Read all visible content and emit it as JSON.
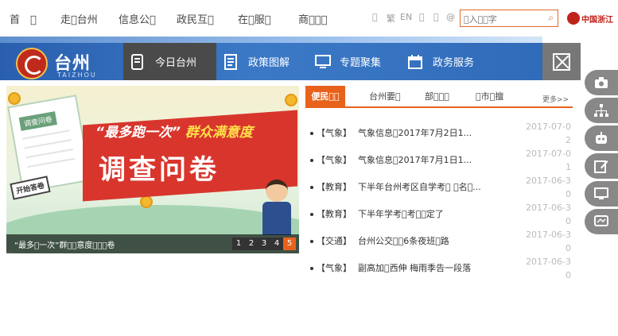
{
  "topnav": {
    "items": [
      "首　󰀀",
      "走󰀀台州",
      "信息公󰀀",
      "政民互󰀀",
      "在󰀀服󰀀",
      "商󰀀󰀀󰀀"
    ],
    "util": [
      "󰀀",
      "繁",
      "EN",
      "󰀀",
      "󰀀",
      "@"
    ],
    "search_placeholder": "󰀀入󰀀󰀀字",
    "zj_logo": "中国浙江"
  },
  "header": {
    "logo_cn": "台州",
    "logo_en": "TAIZHOU",
    "nav": [
      {
        "label": "今日台州",
        "icon": "phone-news-icon"
      },
      {
        "label": "政策图解",
        "icon": "document-icon"
      },
      {
        "label": "专题聚集",
        "icon": "monitor-icon"
      },
      {
        "label": "政务服务",
        "icon": "calendar-icon"
      }
    ]
  },
  "banner": {
    "paper_title": "调查问卷",
    "stamp": "开始答卷",
    "subtitle_a": "“最多跑一次”",
    "subtitle_b": "群众满意度",
    "big_title": "调查问卷",
    "caption": "“最多󰀀一次”群󰀀󰀀意度󰀀󰀀󰀀卷",
    "pages": [
      "1",
      "2",
      "3",
      "4",
      "5"
    ],
    "active_page": "5"
  },
  "tabs": [
    "便民󰀀󰀀",
    "台州要󰀀",
    "部󰀀󰀀󰀀",
    "󰀀市󰀀擅"
  ],
  "more": "更多>>",
  "news": [
    {
      "cat": "【气象】",
      "title": "气象信息󰀀2017年7月2日1...",
      "date": "2017-07-02"
    },
    {
      "cat": "【气象】",
      "title": "气象信息󰀀2017年7月1日1...",
      "date": "2017-07-01"
    },
    {
      "cat": "【教育】",
      "title": "下半年台州考区自学考󰀀 󰀀名󰀀...",
      "date": "2017-06-30"
    },
    {
      "cat": "【教育】",
      "title": "下半年学考󰀀考󰀀󰀀定了",
      "date": "2017-06-30"
    },
    {
      "cat": "【交通】",
      "title": "台州公交󰀀󰀀6条夜班󰀀路",
      "date": "2017-06-30"
    },
    {
      "cat": "【气象】",
      "title": "副高加󰀀西伸 梅雨季告一段落",
      "date": "2017-06-30"
    }
  ],
  "floatbar": [
    "camera-icon",
    "sitemap-icon",
    "robot-icon",
    "edit-icon",
    "desktop-icon",
    "screen-icon"
  ],
  "colors": {
    "accent": "#e8621c",
    "header_blue": "#3b79c6",
    "brand_red": "#c0221a"
  }
}
